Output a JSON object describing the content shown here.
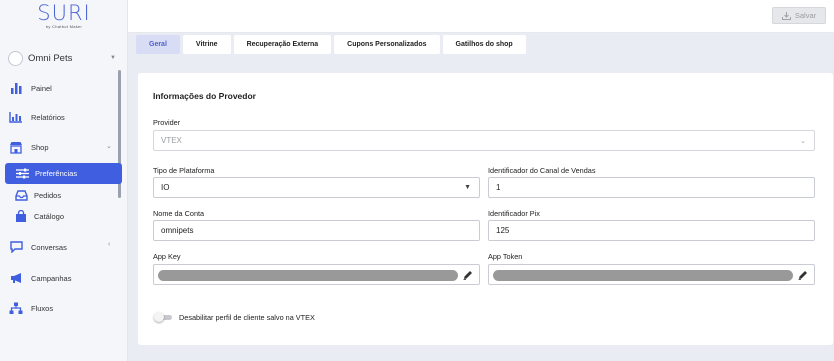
{
  "brand": {
    "name": "SURI",
    "tagline": "by Chatbot Maker",
    "accent": "#3f5ee0"
  },
  "account": {
    "name": "Omni Pets"
  },
  "sidebar": {
    "items": [
      {
        "label": "Painel",
        "icon": "bar-chart-icon"
      },
      {
        "label": "Relatórios",
        "icon": "report-chart-icon"
      },
      {
        "label": "Shop",
        "icon": "store-icon"
      },
      {
        "label": "Preferências",
        "icon": "sliders-icon",
        "active": true
      },
      {
        "label": "Pedidos",
        "icon": "inbox-tray-icon"
      },
      {
        "label": "Catálogo",
        "icon": "shopping-bag-icon"
      },
      {
        "label": "Conversas",
        "icon": "chat-bubble-icon"
      },
      {
        "label": "Campanhas",
        "icon": "megaphone-icon"
      },
      {
        "label": "Fluxos",
        "icon": "flow-diagram-icon"
      }
    ]
  },
  "header": {
    "save_label": "Salvar"
  },
  "tabs": [
    {
      "label": "Geral",
      "active": true
    },
    {
      "label": "Vitrine"
    },
    {
      "label": "Recuperação Externa"
    },
    {
      "label": "Cupons Personalizados"
    },
    {
      "label": "Gatilhos do shop"
    }
  ],
  "form": {
    "title": "Informações do Provedor",
    "provider": {
      "label": "Provider",
      "value": "VTEX"
    },
    "platform_type": {
      "label": "Tipo de Plataforma",
      "value": "IO"
    },
    "sales_channel": {
      "label": "Identificador do Canal de Vendas",
      "value": "1"
    },
    "account_name": {
      "label": "Nome da Conta",
      "value": "omnipets"
    },
    "pix_id": {
      "label": "Identificador Pix",
      "value": "125"
    },
    "app_key": {
      "label": "App Key"
    },
    "app_token": {
      "label": "App Token"
    },
    "disable_profile_toggle": {
      "label": "Desabilitar perfil de cliente salvo na VTEX",
      "on": false
    }
  }
}
